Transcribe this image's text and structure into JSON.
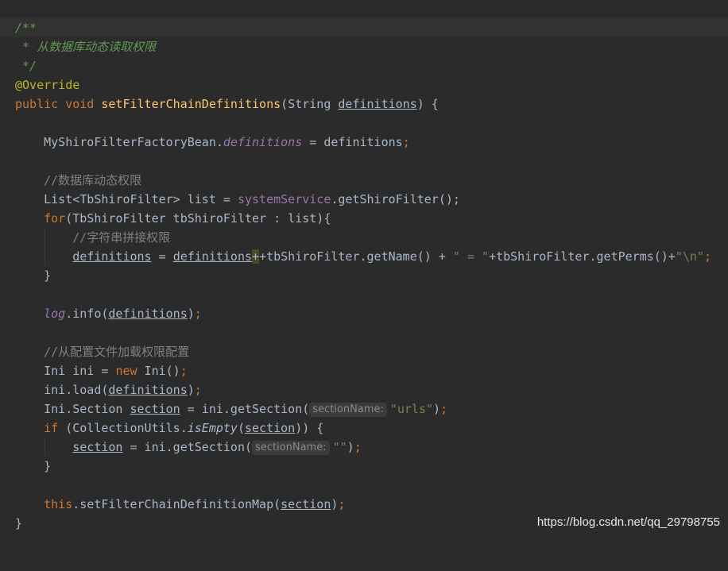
{
  "editor": {
    "doc_open": "/**",
    "doc_line": " * 从数据库动态读取权限",
    "doc_close": " */",
    "annotation": "@Override",
    "kw_public": "public",
    "kw_void": "void",
    "method_name": "setFilterChainDefinitions",
    "param_type": "String",
    "param_name": "definitions",
    "class_name": "MyShiroFilterFactoryBean",
    "static_field": "definitions",
    "comment_dynamic": "//数据库动态权限",
    "list_decl": "List<TbShiroFilter> list = ",
    "service_field": "systemService",
    "get_filter_call": ".getShiroFilter();",
    "kw_for": "for",
    "for_body": "(TbShiroFilter tbShiroFilter : list){",
    "comment_concat": "//字符串拼接权限",
    "concat_mid": "+tbShiroFilter.getName() + ",
    "str_eq": "\" = \"",
    "concat_perms": "+tbShiroFilter.getPerms()+",
    "str_newline": "\"\\n\"",
    "log_field": "log",
    "log_call": ".info(",
    "comment_config": "//从配置文件加载权限配置",
    "ini_decl": "Ini ini = ",
    "kw_new": "new",
    "ini_ctor": " Ini()",
    "ini_load": "ini.load(",
    "section_type": "Ini.Section ",
    "var_section": "section",
    "get_section": " = ini.getSection(",
    "hint_section_name": "sectionName:",
    "str_urls": "\"urls\"",
    "kw_if": "if",
    "if_head": " (CollectionUtils.",
    "is_empty": "isEmpty",
    "str_empty": "\"\"",
    "kw_this": "this",
    "set_map": ".setFilterChainDefinitionMap(",
    "close_brace": "}"
  },
  "watermark": "https://blog.csdn.net/qq_29798755"
}
